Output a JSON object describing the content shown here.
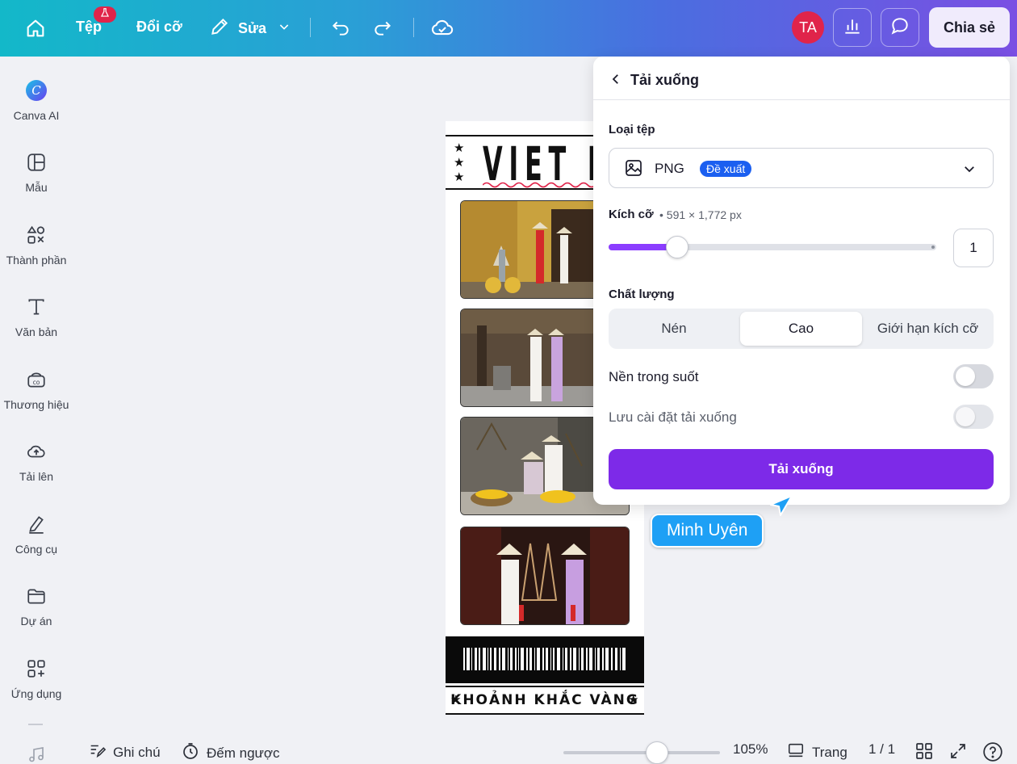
{
  "topbar": {
    "file_label": "Tệp",
    "resize_label": "Đổi cỡ",
    "edit_label": "Sửa",
    "avatar_initials": "TA",
    "share_label": "Chia sẻ",
    "icons": [
      "home-icon",
      "flask-icon",
      "pencil-icon",
      "chevron-down-icon",
      "undo-icon",
      "redo-icon",
      "cloud-check-icon",
      "chart-icon",
      "comment-icon"
    ]
  },
  "sidebar": {
    "items": [
      {
        "label": "Canva AI",
        "icon": "canva-ai-icon"
      },
      {
        "label": "Mẫu",
        "icon": "template-icon"
      },
      {
        "label": "Thành phần",
        "icon": "elements-icon"
      },
      {
        "label": "Văn bản",
        "icon": "text-icon"
      },
      {
        "label": "Thương hiệu",
        "icon": "brand-icon"
      },
      {
        "label": "Tải lên",
        "icon": "upload-icon"
      },
      {
        "label": "Công cụ",
        "icon": "tools-icon"
      },
      {
        "label": "Dự án",
        "icon": "folder-icon"
      },
      {
        "label": "Ứng dụng",
        "icon": "apps-icon"
      }
    ]
  },
  "design": {
    "title": "VIET NA",
    "footer_text": "KHOẢNH KHẮC VÀNG"
  },
  "panel": {
    "title": "Tải xuống",
    "file_type_label": "Loại tệp",
    "file_type_value": "PNG",
    "recommended_badge": "Đề xuất",
    "size_label": "Kích cỡ",
    "size_meta": "• 591 × 1,772 px",
    "size_multiplier": "1",
    "size_slider_fraction": 0.21,
    "quality_label": "Chất lượng",
    "quality_options": [
      "Nén",
      "Cao",
      "Giới hạn kích cỡ"
    ],
    "quality_selected": "Cao",
    "transparent_bg_label": "Nền trong suốt",
    "transparent_bg_on": false,
    "save_settings_label": "Lưu cài đặt tải xuống",
    "save_settings_on": false,
    "download_button": "Tải xuống"
  },
  "collaborator": {
    "name": "Minh Uyên",
    "color": "#1ea0f5"
  },
  "bottombar": {
    "notes_label": "Ghi chú",
    "timer_label": "Đếm ngược",
    "zoom_value": "105%",
    "page_label": "Trang",
    "page_count": "1 / 1"
  },
  "colors": {
    "accent_purple": "#7d2ae8",
    "badge_blue": "#1b5ff0",
    "avatar_red": "#e0244a"
  }
}
